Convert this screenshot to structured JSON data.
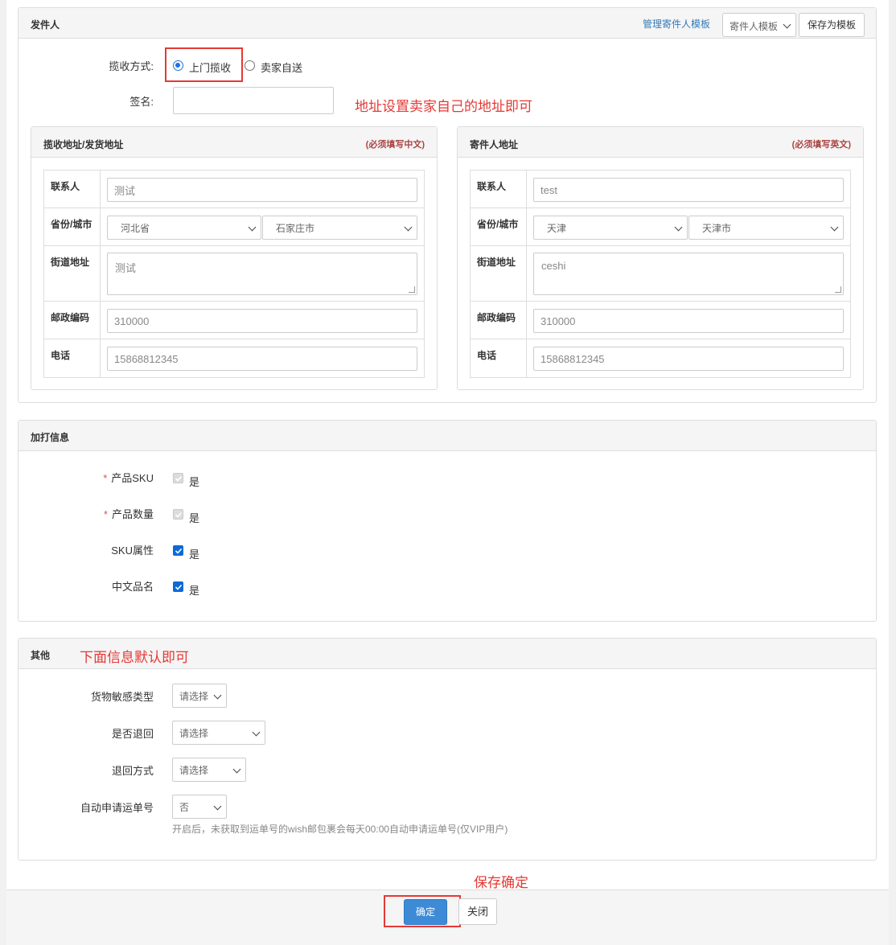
{
  "sender": {
    "title": "发件人",
    "manage_link": "管理寄件人模板",
    "template_select": "寄件人模板",
    "save_template": "保存为模板",
    "pickup_label": "揽收方式:",
    "pickup_options": [
      "上门揽收",
      "卖家自送"
    ],
    "pickup_selected": "上门揽收",
    "sign_label": "签名:",
    "sign_value": "",
    "note": "地址设置卖家自己的地址即可"
  },
  "pickup_address": {
    "title": "揽收地址/发货地址",
    "required": "(必须填写中文)",
    "contact_label": "联系人",
    "contact_value": "测试",
    "province_label": "省份/城市",
    "province": "河北省",
    "city": "石家庄市",
    "street_label": "街道地址",
    "street_value": "测试",
    "zip_label": "邮政编码",
    "zip_value": "310000",
    "phone_label": "电话",
    "phone_value": "15868812345"
  },
  "sender_address": {
    "title": "寄件人地址",
    "required": "(必须填写英文)",
    "contact_label": "联系人",
    "contact_value": "test",
    "province_label": "省份/城市",
    "province": "天津",
    "city": "天津市",
    "street_label": "街道地址",
    "street_value": "ceshi",
    "zip_label": "邮政编码",
    "zip_value": "310000",
    "phone_label": "电话",
    "phone_value": "15868812345"
  },
  "extra_print": {
    "title": "加打信息",
    "items": [
      {
        "label": "产品SKU",
        "required": true,
        "checked": true,
        "disabled": true,
        "text": "是"
      },
      {
        "label": "产品数量",
        "required": true,
        "checked": true,
        "disabled": true,
        "text": "是"
      },
      {
        "label": "SKU属性",
        "required": false,
        "checked": true,
        "disabled": false,
        "text": "是"
      },
      {
        "label": "中文品名",
        "required": false,
        "checked": true,
        "disabled": false,
        "text": "是"
      }
    ]
  },
  "other": {
    "title": "其他",
    "note": "下面信息默认即可",
    "sensitive_label": "货物敏感类型",
    "sensitive_value": "请选择",
    "return_label": "是否退回",
    "return_value": "请选择",
    "return_method_label": "退回方式",
    "return_method_value": "请选择",
    "auto_apply_label": "自动申请运单号",
    "auto_apply_value": "否",
    "auto_apply_hint": "开启后，未获取到运单号的wish邮包裹会每天00:00自动申请运单号(仅VIP用户)"
  },
  "footer": {
    "note": "保存确定",
    "confirm": "确定",
    "close": "关闭"
  },
  "colors": {
    "accent": "#337ab7",
    "primary_button": "#3d8bd6",
    "annotation_red": "#e53935",
    "required_red": "#a94442"
  }
}
